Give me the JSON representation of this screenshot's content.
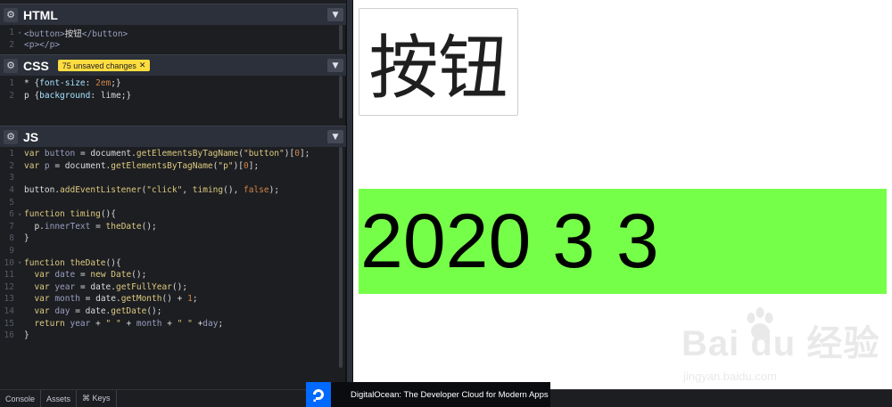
{
  "panels": {
    "html": {
      "title": "HTML",
      "lines": [
        {
          "n": "1",
          "fold": "▾",
          "parts": [
            [
              "tag",
              "<button>"
            ],
            [
              "t",
              "按钮"
            ],
            [
              "tag",
              "</button>"
            ]
          ]
        },
        {
          "n": "2",
          "fold": "",
          "parts": [
            [
              "tag",
              "<p></p>"
            ]
          ]
        }
      ]
    },
    "css": {
      "title": "CSS",
      "badge": "75 unsaved changes",
      "lines": [
        {
          "n": "1",
          "fold": "",
          "parts": [
            [
              "t",
              "* {"
            ],
            [
              "p",
              "font-size"
            ],
            [
              "t",
              ": "
            ],
            [
              "n",
              "2em"
            ],
            [
              "t",
              ";}"
            ]
          ]
        },
        {
          "n": "2",
          "fold": "",
          "parts": [
            [
              "t",
              "p {"
            ],
            [
              "p",
              "background"
            ],
            [
              "t",
              ": "
            ],
            [
              "t",
              "lime"
            ],
            [
              "t",
              ";}"
            ]
          ]
        }
      ]
    },
    "js": {
      "title": "JS",
      "lines": [
        {
          "n": "1",
          "fold": "",
          "parts": [
            [
              "k",
              "var "
            ],
            [
              "v",
              "button"
            ],
            [
              "t",
              " = document."
            ],
            [
              "f",
              "getElementsByTagName"
            ],
            [
              "t",
              "("
            ],
            [
              "s",
              "\"button\""
            ],
            [
              "t",
              ")["
            ],
            [
              "n",
              "0"
            ],
            [
              "t",
              "];"
            ]
          ]
        },
        {
          "n": "2",
          "fold": "",
          "parts": [
            [
              "k",
              "var "
            ],
            [
              "v",
              "p"
            ],
            [
              "t",
              " = document."
            ],
            [
              "f",
              "getElementsByTagName"
            ],
            [
              "t",
              "("
            ],
            [
              "s",
              "\"p\""
            ],
            [
              "t",
              ")["
            ],
            [
              "n",
              "0"
            ],
            [
              "t",
              "];"
            ]
          ]
        },
        {
          "n": "3",
          "fold": "",
          "parts": []
        },
        {
          "n": "4",
          "fold": "",
          "parts": [
            [
              "t",
              "button."
            ],
            [
              "f",
              "addEventListener"
            ],
            [
              "t",
              "("
            ],
            [
              "s",
              "\"click\""
            ],
            [
              "t",
              ", "
            ],
            [
              "f",
              "timing"
            ],
            [
              "t",
              "(), "
            ],
            [
              "n",
              "false"
            ],
            [
              "t",
              ");"
            ]
          ]
        },
        {
          "n": "5",
          "fold": "",
          "parts": []
        },
        {
          "n": "6",
          "fold": "▾",
          "parts": [
            [
              "k",
              "function "
            ],
            [
              "f",
              "timing"
            ],
            [
              "t",
              "(){"
            ]
          ]
        },
        {
          "n": "7",
          "fold": "",
          "parts": [
            [
              "t",
              "  p."
            ],
            [
              "v",
              "innerText"
            ],
            [
              "t",
              " = "
            ],
            [
              "f",
              "theDate"
            ],
            [
              "t",
              "();"
            ]
          ]
        },
        {
          "n": "8",
          "fold": "",
          "parts": [
            [
              "t",
              "}"
            ]
          ]
        },
        {
          "n": "9",
          "fold": "",
          "parts": []
        },
        {
          "n": "10",
          "fold": "▾",
          "parts": [
            [
              "k",
              "function "
            ],
            [
              "f",
              "theDate"
            ],
            [
              "t",
              "(){"
            ]
          ]
        },
        {
          "n": "11",
          "fold": "",
          "parts": [
            [
              "k",
              "  var "
            ],
            [
              "v",
              "date"
            ],
            [
              "t",
              " = "
            ],
            [
              "k",
              "new "
            ],
            [
              "f",
              "Date"
            ],
            [
              "t",
              "();"
            ]
          ]
        },
        {
          "n": "12",
          "fold": "",
          "parts": [
            [
              "k",
              "  var "
            ],
            [
              "v",
              "year"
            ],
            [
              "t",
              " = date."
            ],
            [
              "f",
              "getFullYear"
            ],
            [
              "t",
              "();"
            ]
          ]
        },
        {
          "n": "13",
          "fold": "",
          "parts": [
            [
              "k",
              "  var "
            ],
            [
              "v",
              "month"
            ],
            [
              "t",
              " = date."
            ],
            [
              "f",
              "getMonth"
            ],
            [
              "t",
              "() + "
            ],
            [
              "n",
              "1"
            ],
            [
              "t",
              ";"
            ]
          ]
        },
        {
          "n": "14",
          "fold": "",
          "parts": [
            [
              "k",
              "  var "
            ],
            [
              "v",
              "day"
            ],
            [
              "t",
              " = date."
            ],
            [
              "f",
              "getDate"
            ],
            [
              "t",
              "();"
            ]
          ]
        },
        {
          "n": "15",
          "fold": "",
          "parts": [
            [
              "k",
              "  return "
            ],
            [
              "v",
              "year"
            ],
            [
              "t",
              " + "
            ],
            [
              "s",
              "\" \""
            ],
            [
              "t",
              " + "
            ],
            [
              "v",
              "month"
            ],
            [
              "t",
              " + "
            ],
            [
              "s",
              "\" \""
            ],
            [
              "t",
              " +"
            ],
            [
              "v",
              "day"
            ],
            [
              "t",
              ";"
            ]
          ]
        },
        {
          "n": "16",
          "fold": "",
          "parts": [
            [
              "t",
              "}"
            ]
          ]
        }
      ]
    }
  },
  "preview": {
    "button_label": "按钮",
    "p_text": "2020 3 3",
    "p_background": "#76ff49"
  },
  "watermark": {
    "main": "Bai du 经验",
    "sub": "jingyan.baidu.com"
  },
  "bottombar": {
    "console": "Console",
    "assets": "Assets",
    "keys": "⌘ Keys"
  },
  "ad": {
    "text": "DigitalOcean: The Developer Cloud for Modern Apps"
  },
  "icons": {
    "settings": "gear-icon",
    "collapse": "chevron-down-icon",
    "close_badge": "close-icon",
    "ad_logo": "digitalocean-logo"
  }
}
